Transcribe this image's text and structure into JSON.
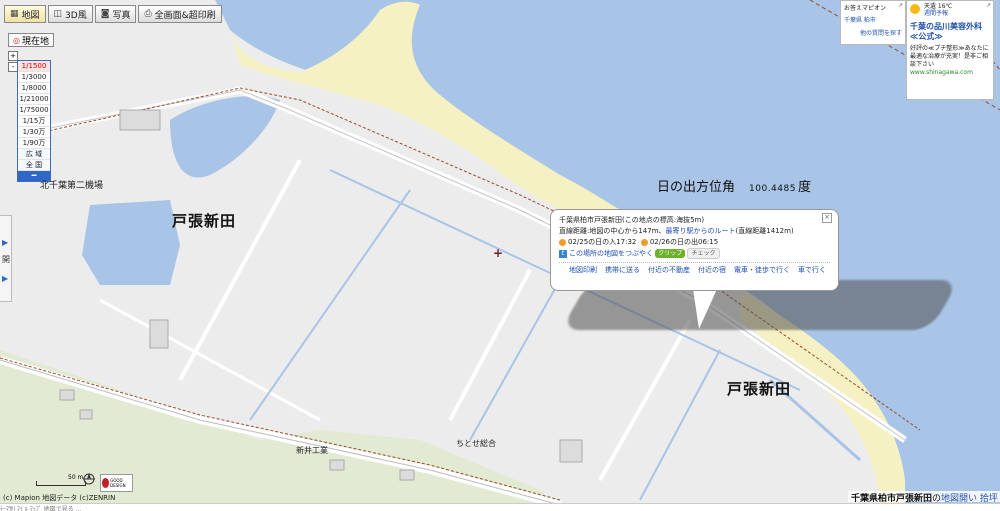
{
  "toolbar": [
    {
      "label": "地図",
      "icon": "map-icon",
      "active": true
    },
    {
      "label": "3D風",
      "icon": "cube-icon",
      "active": false
    },
    {
      "label": "写真",
      "icon": "camera-icon",
      "active": false
    },
    {
      "label": "全画面&超印刷",
      "icon": "printer-icon",
      "active": false
    }
  ],
  "current_location": "現在地",
  "zoom": {
    "plus": "+",
    "minus": "-",
    "scales": [
      "1/1500",
      "1/3000",
      "1/8000",
      "1/21000",
      "1/75000",
      "1/15万",
      "1/30万",
      "1/90万",
      "広 域",
      "全 国"
    ],
    "selected_scale": "1/1500",
    "zoom_button": "━"
  },
  "side_panel": {
    "label": "開"
  },
  "places": {
    "area_main": "戸張新田",
    "area_main_2": "戸張新田",
    "facility": "北千葉第二機場",
    "factory": "新井工業",
    "nursery": "ちとせ総合"
  },
  "sunrise_direction": {
    "label": "日の出方位角",
    "value": "100.4485",
    "unit": "度"
  },
  "popup": {
    "line1": "千葉県柏市戸張新田(この地点の標高:海抜5m)",
    "line2_prefix": "直線距離:地図の中心から147m、",
    "line2_link": "最寄り駅からのルート",
    "line2_suffix": "(直線距離1412m)",
    "sunset": "02/25の日の入17:32",
    "sunrise": "02/26の日の出06:15",
    "tweet_link": "この場所の地図をつぶやく",
    "clip": "クリップ",
    "check": "チェック",
    "actions": [
      "地図印刷",
      "携帯に送る",
      "付近の不動産",
      "付近の宿",
      "電車・徒歩で行く",
      "車で行く"
    ],
    "close": "×"
  },
  "ads": {
    "ad1": {
      "title": "お答えマピオン",
      "corner": "↗",
      "link1": "千葉県 柏市",
      "link2": "他の質問を探す"
    },
    "ad2": {
      "corner": "↗",
      "weather_line1": "天遺 16℃",
      "weather_link": "週間予報",
      "headline": "千葉の品川美容外科≪公式≫",
      "body": "好評の≪プチ整形≫あなたに最適な治療が充実！是非ご相談下さい",
      "url": "www.shinagawa.com"
    }
  },
  "map_scale_label": "50 m",
  "copyright": "(c) Mapion 地図データ (c)ZENRIN",
  "good_design": "GOOD DESIGN",
  "address_bar": {
    "address": "千葉県柏市戸張新田",
    "suffix": "の",
    "link": "地図開い 拾坪"
  },
  "bottom_strip": "ﾃｰﾏ別  ﾏｲ ﾙ ﾏｯﾌﾟ  地図で見る ...",
  "colors": {
    "water": "#a8c4e6",
    "sand": "#f6f1c3",
    "land": "#ececec",
    "green": "#e2ead4",
    "road": "#ffffff",
    "rail": "#9a4a2e",
    "link": "#1f4fb0"
  }
}
